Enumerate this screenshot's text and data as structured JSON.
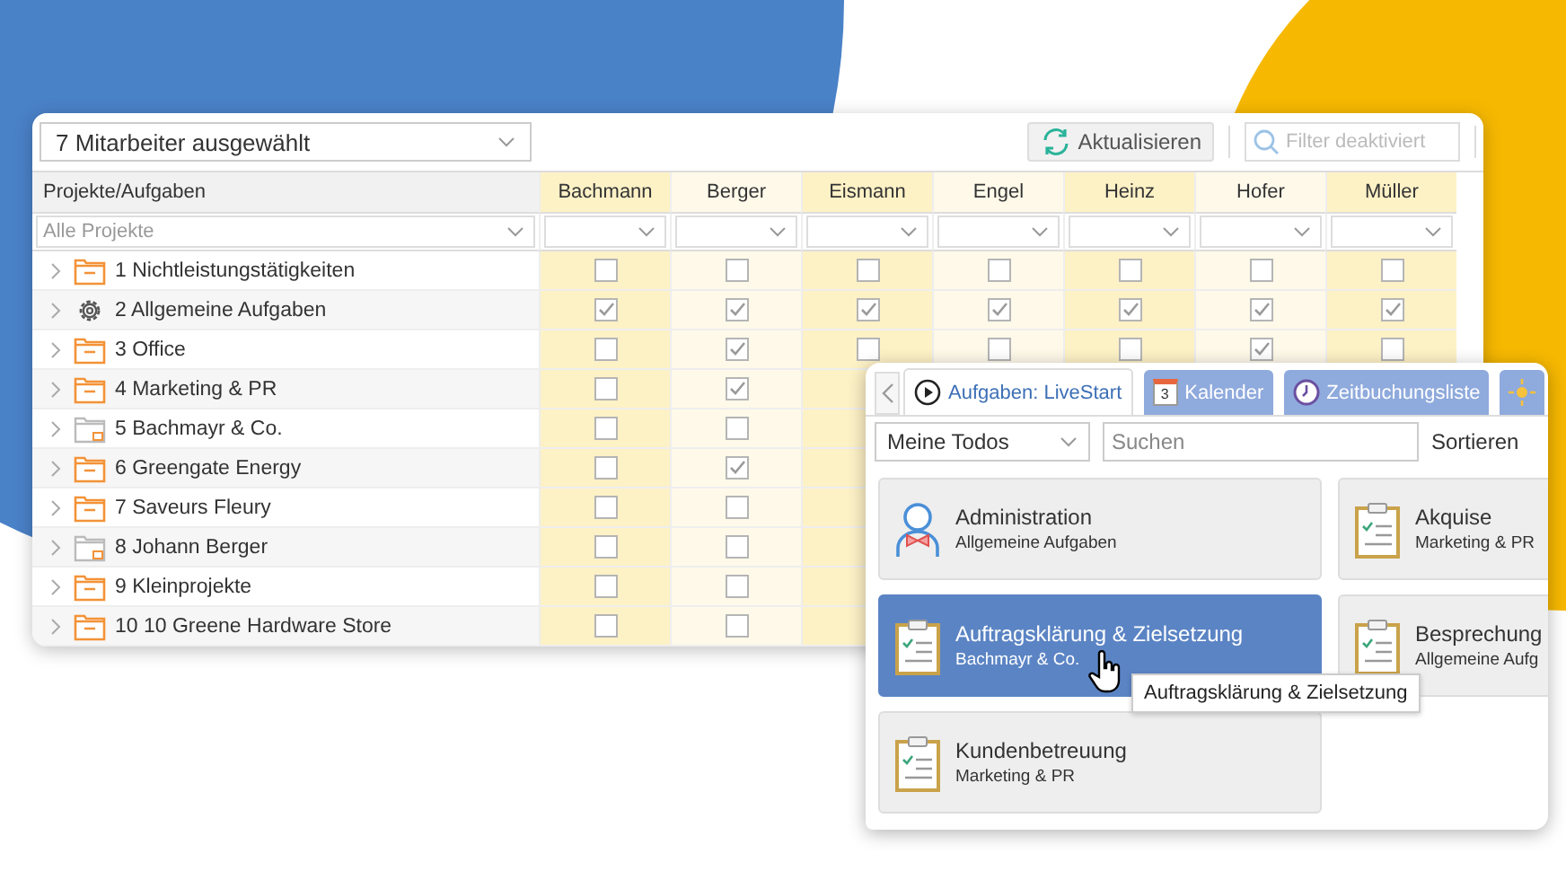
{
  "toolbar": {
    "employee_select": "7 Mitarbeiter ausgewählt",
    "refresh_button": "Aktualisieren",
    "filter_field": {
      "placeholder": "Filter deaktiviert",
      "disabled": true
    }
  },
  "table": {
    "columns": [
      "Projekte/Aufgaben",
      "Bachmann",
      "Berger",
      "Eismann",
      "Engel",
      "Heinz",
      "Hofer",
      "Müller"
    ],
    "project_filter": {
      "placeholder": "Alle Projekte"
    },
    "rows": [
      {
        "name": "1 Nichtleistungstätigkeiten",
        "kind": "folder",
        "checks": [
          false,
          false,
          false,
          false,
          false,
          false,
          false
        ]
      },
      {
        "name": "2 Allgemeine Aufgaben",
        "kind": "settings",
        "checks": [
          true,
          true,
          true,
          true,
          true,
          true,
          true
        ]
      },
      {
        "name": "3 Office",
        "kind": "folder",
        "checks": [
          false,
          true,
          false,
          false,
          false,
          true,
          false
        ]
      },
      {
        "name": "4 Marketing & PR",
        "kind": "folder",
        "checks": [
          false,
          true
        ]
      },
      {
        "name": "5 Bachmayr & Co.",
        "kind": "client",
        "checks": [
          false,
          false
        ]
      },
      {
        "name": "6 Greengate Energy",
        "kind": "folder",
        "checks": [
          false,
          true
        ]
      },
      {
        "name": "7 Saveurs Fleury",
        "kind": "folder",
        "checks": [
          false,
          false
        ]
      },
      {
        "name": "8 Johann Berger",
        "kind": "client",
        "checks": [
          false,
          false
        ]
      },
      {
        "name": "9 Kleinprojekte",
        "kind": "folder",
        "checks": [
          false,
          false
        ]
      },
      {
        "name": "10 10 Greene Hardware Store",
        "kind": "folder",
        "checks": [
          false,
          false
        ]
      }
    ]
  },
  "panel": {
    "tabs": [
      {
        "label": "Aufgaben: LiveStart",
        "kind": "live",
        "selected": true
      },
      {
        "label": "Kalender",
        "kind": "calendar",
        "calendar_day": "3",
        "selected": false
      },
      {
        "label": "Zeitbuchungsliste",
        "kind": "time",
        "selected": false
      },
      {
        "kind": "weather",
        "selected": false
      }
    ],
    "scope_select": "Meine Todos",
    "search": {
      "placeholder": "Suchen"
    },
    "sort_label": "Sortieren",
    "cards": [
      {
        "title": "Administration",
        "subtitle": "Allgemeine Aufgaben",
        "kind": "person",
        "selected": false
      },
      {
        "title": "Akquise",
        "subtitle": "Marketing & PR",
        "kind": "task",
        "selected": false
      },
      {
        "title": "Auftragsklärung & Zielsetzung",
        "subtitle": "Bachmayr & Co.",
        "kind": "task",
        "selected": true
      },
      {
        "title": "Besprechung",
        "subtitle": "Allgemeine Aufg",
        "kind": "task",
        "selected": false
      },
      {
        "title": "Kundenbetreuung",
        "subtitle": "Marketing & PR",
        "kind": "task",
        "selected": false
      }
    ],
    "tooltip": "Auftragsklärung & Zielsetzung"
  }
}
